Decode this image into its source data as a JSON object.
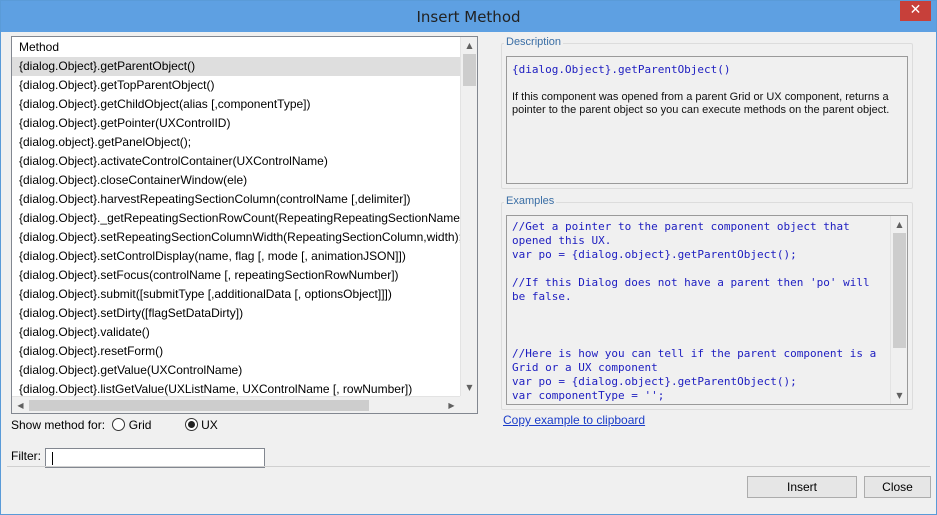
{
  "window": {
    "title": "Insert Method",
    "close_glyph": "✕"
  },
  "method_list": {
    "header": "Method",
    "selected_index": 0,
    "items": [
      "{dialog.Object}.getParentObject()",
      "{dialog.Object}.getTopParentObject()",
      "{dialog.Object}.getChildObject(alias [,componentType])",
      "{dialog.Object}.getPointer(UXControlID)",
      "{dialog.object}.getPanelObject();",
      "{dialog.Object}.activateControlContainer(UXControlName)",
      "{dialog.Object}.closeContainerWindow(ele)",
      "{dialog.Object}.harvestRepeatingSectionColumn(controlName [,delimiter])",
      "{dialog.Object}._getRepeatingSectionRowCount(RepeatingRepeatingSectionName);",
      "{dialog.Object}.setRepeatingSectionColumnWidth(RepeatingSectionColumn,width);",
      "{dialog.Object}.setControlDisplay(name, flag [, mode [, animationJSON]])",
      "{dialog.Object}.setFocus(controlName [, repeatingSectionRowNumber])",
      "{dialog.Object}.submit([submitType [,additionalData [, optionsObject]]])",
      "{dialog.Object}.setDirty([flagSetDataDirty])",
      "{dialog.Object}.validate()",
      "{dialog.Object}.resetForm()",
      "{dialog.Object}.getValue(UXControlName)",
      "{dialog.Object}.listGetValue(UXListName, UXControlName [, rowNumber])"
    ]
  },
  "show_method_for": {
    "label": "Show method for:",
    "options": [
      {
        "label": "Grid",
        "checked": false
      },
      {
        "label": "UX",
        "checked": true
      }
    ]
  },
  "filter": {
    "label": "Filter:",
    "value": ""
  },
  "description": {
    "group_label": "Description",
    "signature": "{dialog.Object}.getParentObject()",
    "text": "If this component was opened from a parent Grid or UX component, returns a pointer to the parent object so you can execute methods on the parent object."
  },
  "examples": {
    "group_label": "Examples",
    "code": "//Get a pointer to the parent component object that opened this UX.\nvar po = {dialog.object}.getParentObject();\n\n//If this Dialog does not have a parent then 'po' will be false.\n\n\n\n//Here is how you can tell if the parent component is a Grid or a UX component\nvar po = {dialog.object}.getParentObject();\nvar componentType = '';\nif(po) {"
  },
  "copy_link": "Copy example to clipboard",
  "buttons": {
    "insert": "Insert",
    "close": "Close"
  },
  "scroll_arrows": {
    "up": "▲",
    "down": "▼",
    "left": "◀",
    "right": "▶"
  }
}
